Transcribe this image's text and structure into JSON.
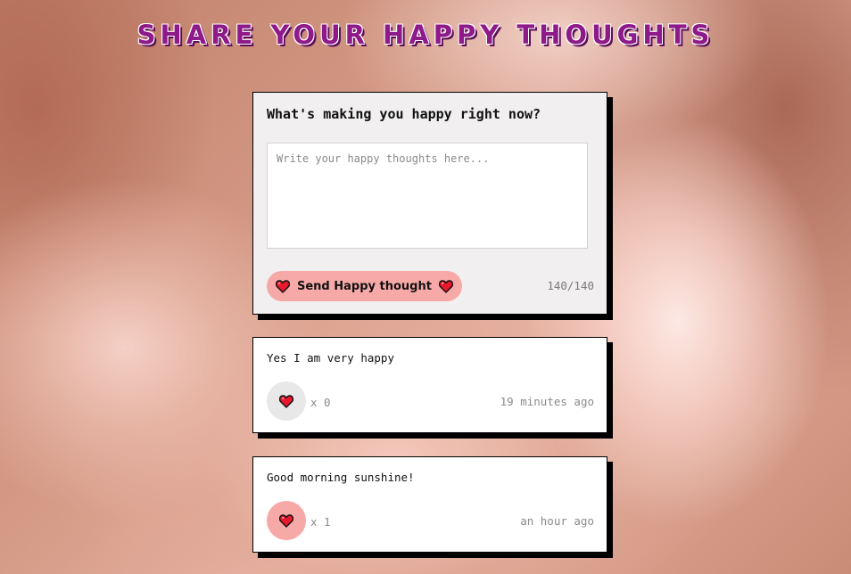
{
  "header": {
    "title": "SHARE YOUR HAPPY THOUGHTS"
  },
  "form": {
    "question": "What's making you happy right now?",
    "placeholder": "Write your happy thoughts here...",
    "value": "",
    "send_label": "Send Happy thought",
    "char_count": "140/140",
    "icon": "heart-icon"
  },
  "thoughts": [
    {
      "message": "Yes I am very happy",
      "likes": "x 0",
      "time": "19 minutes ago",
      "liked": false
    },
    {
      "message": "Good morning sunshine!",
      "likes": "x 1",
      "time": "an hour ago",
      "liked": true
    }
  ],
  "colors": {
    "title": "#8e1a8a",
    "accent_pink": "#f7a9a8",
    "heart_red": "#e8192c",
    "form_background": "#f1efef",
    "card_background": "#ffffff"
  }
}
